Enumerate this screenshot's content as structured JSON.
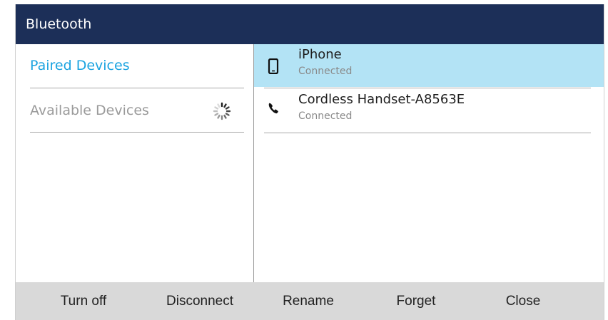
{
  "title": "Bluetooth",
  "sidebar": {
    "items": [
      {
        "label": "Paired Devices",
        "state": "selected",
        "color": "#1aa3e0"
      },
      {
        "label": "Available Devices",
        "state": "scanning",
        "icon": "loading-spinner-icon"
      }
    ]
  },
  "devices": [
    {
      "name": "iPhone",
      "status": "Connected",
      "icon": "mobile-phone-icon",
      "selected": true
    },
    {
      "name": "Cordless Handset-A8563E",
      "status": "Connected",
      "icon": "handset-icon",
      "selected": false
    }
  ],
  "softkeys": {
    "turn_off": "Turn off",
    "disconnect": "Disconnect",
    "rename": "Rename",
    "forget": "Forget",
    "close": "Close"
  },
  "colors": {
    "title_bar": "#1c2f58",
    "accent": "#1aa3e0",
    "selection": "#b3e3f5",
    "softkey_bar": "#d9d9d9"
  }
}
